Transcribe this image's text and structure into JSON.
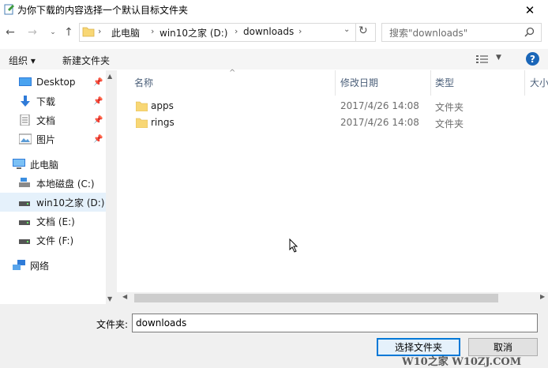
{
  "window": {
    "title": "为你下载的内容选择一个默认目标文件夹",
    "close_label": "✕"
  },
  "nav": {
    "path": [
      "此电脑",
      "win10之家 (D:)",
      "downloads"
    ],
    "search_placeholder": "搜索\"downloads\""
  },
  "toolbar": {
    "organize": "组织 ▾",
    "new_folder": "新建文件夹"
  },
  "sidebar": {
    "quick_access": [
      {
        "label": "Desktop",
        "icon": "desktop-icon",
        "pinned": true
      },
      {
        "label": "下载",
        "icon": "download-arrow-icon",
        "pinned": true
      },
      {
        "label": "文档",
        "icon": "document-icon",
        "pinned": true
      },
      {
        "label": "图片",
        "icon": "picture-icon",
        "pinned": true
      }
    ],
    "this_pc": "此电脑",
    "drives": [
      {
        "label": "本地磁盘 (C:)",
        "icon": "drive-icon"
      },
      {
        "label": "win10之家 (D:)",
        "icon": "drive-icon",
        "selected": true
      },
      {
        "label": "文档 (E:)",
        "icon": "drive-icon"
      },
      {
        "label": "文件 (F:)",
        "icon": "drive-icon"
      }
    ],
    "network": "网络"
  },
  "filelist": {
    "columns": [
      "名称",
      "修改日期",
      "类型",
      "大小"
    ],
    "rows": [
      {
        "name": "apps",
        "date": "2017/4/26 14:08",
        "type": "文件夹"
      },
      {
        "name": "rings",
        "date": "2017/4/26 14:08",
        "type": "文件夹"
      }
    ]
  },
  "footer": {
    "filename_label": "文件夹:",
    "filename_value": "downloads",
    "select_label": "选择文件夹",
    "cancel_label": "取消"
  },
  "watermark": "W10之家 W10ZJ.COM"
}
